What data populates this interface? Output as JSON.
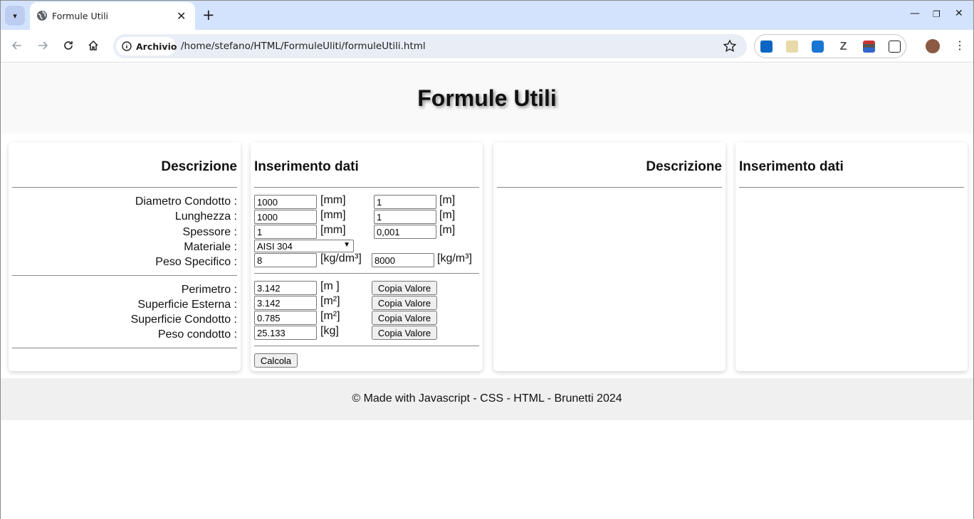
{
  "browser": {
    "tab_title": "Formule Utili",
    "chip_label": "Archivio",
    "url": "/home/stefano/HTML/FormuleUliti/formuleUtili.html"
  },
  "page": {
    "title": "Formule Utili",
    "footer": "© Made with Javascript - CSS - HTML - Brunetti 2024"
  },
  "left_card": {
    "heading": "Descrizione"
  },
  "data_card": {
    "heading": "Inserimento dati"
  },
  "right_card1": {
    "heading": "Descrizione"
  },
  "right_card2": {
    "heading": "Inserimento dati"
  },
  "inputs": [
    {
      "label": "Diametro Condotto :",
      "value_mm": "1000",
      "unit1": "[mm]",
      "value_m": "1",
      "unit2": "[m]"
    },
    {
      "label": "Lunghezza :",
      "value_mm": "1000",
      "unit1": "[mm]",
      "value_m": "1",
      "unit2": "[m]"
    },
    {
      "label": "Spessore :",
      "value_mm": "1",
      "unit1": "[mm]",
      "value_m": "0,001",
      "unit2": "[m]"
    }
  ],
  "materiale": {
    "label": "Materiale :",
    "selected": "AISI 304"
  },
  "peso_specifico": {
    "label": "Peso Specifico :",
    "value1": "8",
    "unit1": "[kg/dm³]",
    "value2": "8000",
    "unit2": "[kg/m³]"
  },
  "results": [
    {
      "label": "Perimetro :",
      "value": "3.142",
      "unit": "[m ]"
    },
    {
      "label": "Superficie Esterna :",
      "value": "3.142",
      "unit": "[m²]"
    },
    {
      "label": "Superficie Condotto :",
      "value": "0.785",
      "unit": "[m²]"
    },
    {
      "label": "Peso condotto :",
      "value": "25.133",
      "unit": "[kg]"
    }
  ],
  "copy_button_label": "Copia Valore",
  "calc_button_label": "Calcola"
}
